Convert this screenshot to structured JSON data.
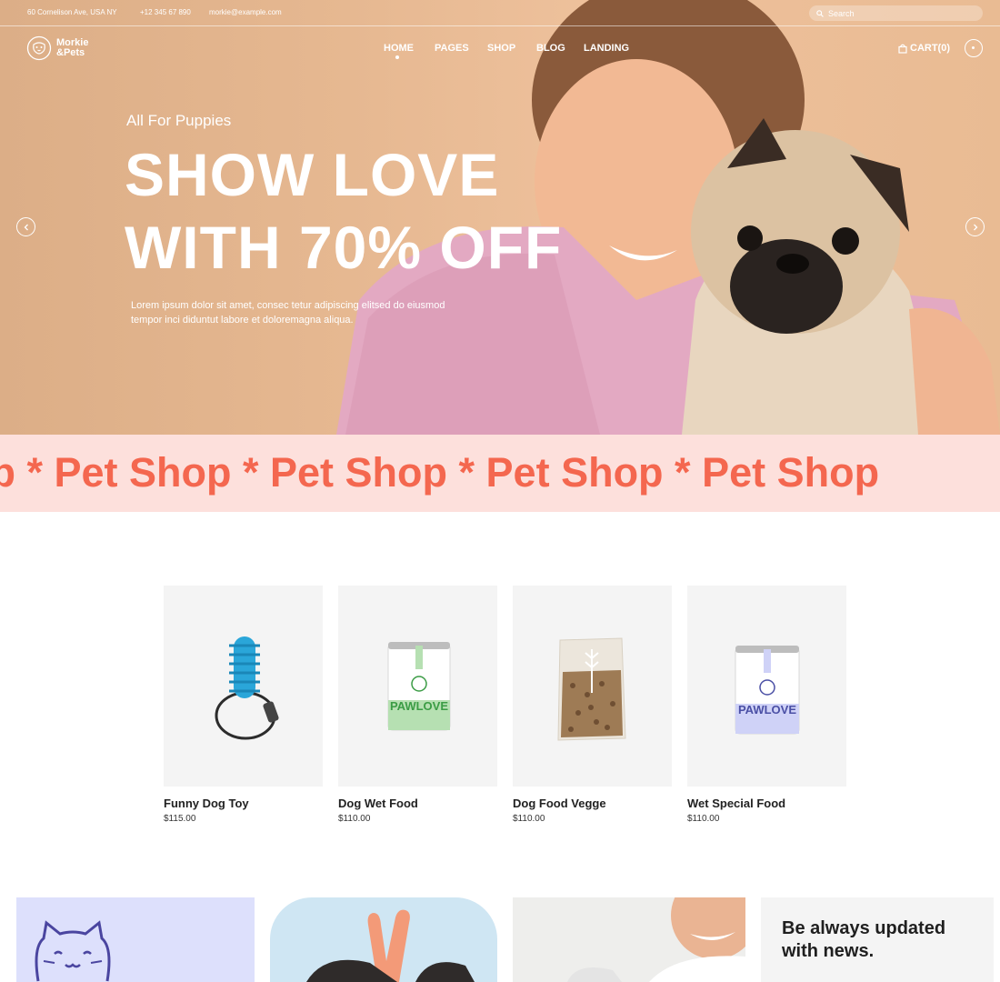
{
  "topbar": {
    "address": "60 Cornelison Ave, USA NY",
    "phone": "+12 345 67 890",
    "email": "morkie@example.com",
    "search_placeholder": "Search"
  },
  "logo": {
    "line1": "Morkie",
    "line2": "&Pets"
  },
  "nav": {
    "items": [
      "HOME",
      "PAGES",
      "SHOP",
      "BLOG",
      "LANDING"
    ],
    "active": "HOME"
  },
  "cart": {
    "label": "CART(0)"
  },
  "hero": {
    "eyebrow": "All For Puppies",
    "headline_line1": "SHOW LOVE",
    "headline_line2": "WITH 70% OFF",
    "lead_line1": "Lorem ipsum dolor sit amet, consec tetur adipiscing elitsed do eiusmod",
    "lead_line2": "tempor inci diduntut labore et doloremagna aliqua."
  },
  "marquee": {
    "text": "op * Pet Shop * Pet Shop * Pet Shop * Pet Shop"
  },
  "products": [
    {
      "name": "Funny Dog Toy",
      "price": "$115.00"
    },
    {
      "name": "Dog Wet Food",
      "price": "$110.00"
    },
    {
      "name": "Dog Food Vegge",
      "price": "$110.00"
    },
    {
      "name": "Wet Special Food",
      "price": "$110.00"
    }
  ],
  "tiles": {
    "news_line1": "Be always updated",
    "news_line2": "with news."
  },
  "colors": {
    "accent": "#f4674f",
    "marquee_bg": "#fde0dc",
    "hero_bg": "#e6b891",
    "tile_lavender": "#dde0fc",
    "tile_sky": "#cfe6f3",
    "product_bg": "#f4f4f4"
  }
}
